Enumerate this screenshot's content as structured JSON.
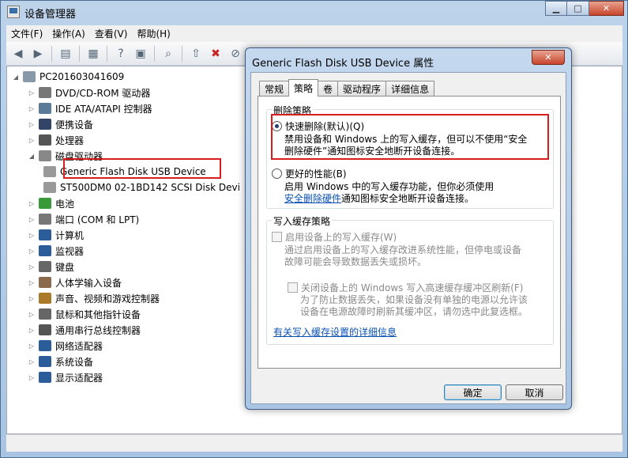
{
  "window": {
    "title": "设备管理器",
    "btn_min": "▁",
    "btn_max": "□",
    "btn_close": "✕"
  },
  "menu": [
    "文件(F)",
    "操作(A)",
    "查看(V)",
    "帮助(H)"
  ],
  "tree": {
    "root": "PC201603041609",
    "items": [
      {
        "label": "DVD/CD-ROM 驱动器",
        "color": "#777777"
      },
      {
        "label": "IDE ATA/ATAPI 控制器",
        "color": "#5a7a9a"
      },
      {
        "label": "便携设备",
        "color": "#334466"
      },
      {
        "label": "处理器",
        "color": "#555555"
      },
      {
        "label": "磁盘驱动器",
        "color": "#888888",
        "expanded": true
      },
      {
        "label": "Generic Flash Disk USB Device",
        "color": "#999999",
        "child": true
      },
      {
        "label": "ST500DM0 02-1BD142 SCSI Disk Devi",
        "color": "#999999",
        "child": true
      },
      {
        "label": "电池",
        "color": "#3a9a3a"
      },
      {
        "label": "端口 (COM 和 LPT)",
        "color": "#777777"
      },
      {
        "label": "计算机",
        "color": "#2a5d9a"
      },
      {
        "label": "监视器",
        "color": "#2a5d9a"
      },
      {
        "label": "键盘",
        "color": "#666666"
      },
      {
        "label": "人体学输入设备",
        "color": "#8a6a4a"
      },
      {
        "label": "声音、视频和游戏控制器",
        "color": "#aa7a2a"
      },
      {
        "label": "鼠标和其他指针设备",
        "color": "#666666"
      },
      {
        "label": "通用串行总线控制器",
        "color": "#555555"
      },
      {
        "label": "网络适配器",
        "color": "#2a5d9a"
      },
      {
        "label": "系统设备",
        "color": "#2a5d9a"
      },
      {
        "label": "显示适配器",
        "color": "#2a5d9a"
      }
    ]
  },
  "dialog": {
    "title": "Generic Flash Disk USB Device 属性",
    "close": "✕",
    "tabs": [
      "常规",
      "策略",
      "卷",
      "驱动程序",
      "详细信息"
    ],
    "removal_group": "删除策略",
    "quick_removal": {
      "label": "快速删除(默认)(Q)",
      "desc1": "禁用设备和 Windows 上的写入缓存，但可以不使用“安全",
      "desc2": "删除硬件”通知图标安全地断开设备连接。"
    },
    "better_perf": {
      "label": "更好的性能(B)",
      "desc1": "启用 Windows 中的写入缓存功能，但你必须使用",
      "desc2_link": "安全删除硬件",
      "desc2_rest": "通知图标安全地断开设备连接。"
    },
    "cache_group": "写入缓存策略",
    "enable_cache": {
      "label": "启用设备上的写入缓存(W)",
      "desc1": "通过启用设备上的写入缓存改进系统性能，但停电或设备",
      "desc2": "故障可能会导致数据丢失或损坏。"
    },
    "flush_cache": {
      "label": "关闭设备上的 Windows 写入高速缓存缓冲区刷新(F)",
      "desc1": "为了防止数据丢失，如果设备没有单独的电源以允许该",
      "desc2": "设备在电源故障时刷新其缓冲区，请勿选中此复选框。"
    },
    "more_link": "有关写入缓存设置的详细信息",
    "ok": "确定",
    "cancel": "取消"
  }
}
